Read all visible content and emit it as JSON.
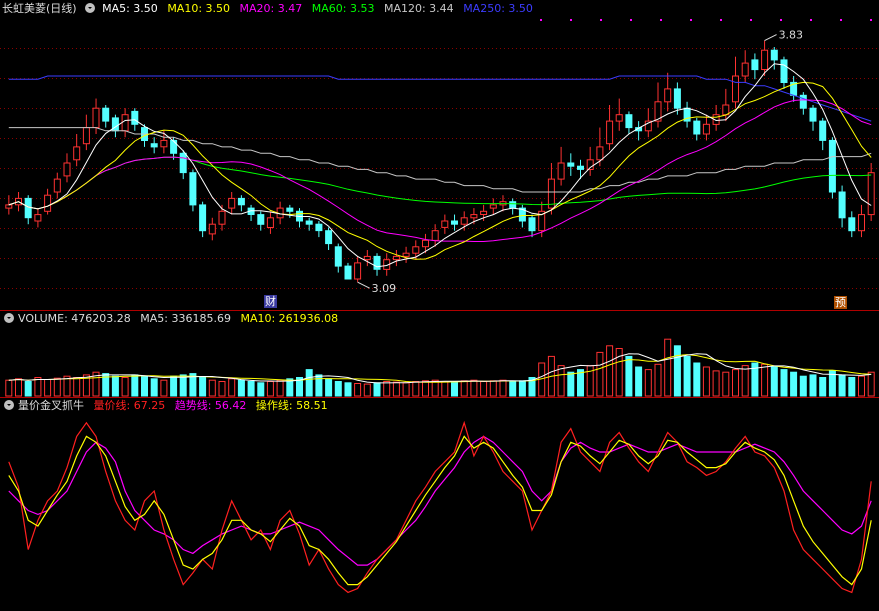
{
  "colors": {
    "background": "#000000",
    "up": "#ff3232",
    "down": "#54ffff",
    "grid": "#8b0000",
    "ma5": "#ffffff",
    "ma10": "#ffff00",
    "ma20": "#ff00ff",
    "ma60": "#00ff00",
    "ma120": "#c8c8c8",
    "ma250": "#3c3cff",
    "ind_red": "#ff2020",
    "ind_magenta": "#ff00ff",
    "ind_yellow": "#ffff00"
  },
  "price_panel": {
    "stock_name": "长虹美菱(日线)",
    "ma5": "MA5: 3.50",
    "ma10": "MA10: 3.50",
    "ma20": "MA20: 3.47",
    "ma60": "MA60: 3.53",
    "ma120": "MA120: 3.44",
    "ma250": "MA250: 3.50",
    "high_label": "3.83",
    "low_label": "3.09",
    "marker_left": "财",
    "marker_right": "预"
  },
  "volume_panel": {
    "volume": "VOLUME: 476203.28",
    "ma5": "MA5: 336185.69",
    "ma10": "MA10: 261936.08"
  },
  "indicator_panel": {
    "title": "量价金叉抓牛",
    "line1": "量价线: 67.25",
    "line2": "趋势线: 56.42",
    "line3": "操作线: 58.51"
  },
  "chart_data": [
    {
      "type": "candlestick",
      "series_key": "price",
      "ylim": [
        3.0,
        3.9
      ],
      "close": [
        3.32,
        3.34,
        3.28,
        3.29,
        3.35,
        3.4,
        3.45,
        3.5,
        3.56,
        3.62,
        3.58,
        3.55,
        3.6,
        3.57,
        3.52,
        3.5,
        3.52,
        3.48,
        3.42,
        3.32,
        3.24,
        3.26,
        3.3,
        3.34,
        3.32,
        3.29,
        3.26,
        3.28,
        3.31,
        3.3,
        3.27,
        3.26,
        3.24,
        3.2,
        3.13,
        3.09,
        3.14,
        3.16,
        3.12,
        3.15,
        3.16,
        3.17,
        3.19,
        3.21,
        3.24,
        3.27,
        3.26,
        3.28,
        3.29,
        3.3,
        3.32,
        3.33,
        3.31,
        3.27,
        3.24,
        3.3,
        3.4,
        3.45,
        3.44,
        3.43,
        3.46,
        3.5,
        3.58,
        3.6,
        3.56,
        3.55,
        3.58,
        3.64,
        3.68,
        3.62,
        3.58,
        3.54,
        3.57,
        3.6,
        3.63,
        3.72,
        3.76,
        3.74,
        3.8,
        3.77,
        3.7,
        3.66,
        3.62,
        3.58,
        3.52,
        3.36,
        3.28,
        3.24,
        3.29,
        3.42
      ],
      "open": [
        3.31,
        3.32,
        3.34,
        3.27,
        3.3,
        3.36,
        3.41,
        3.46,
        3.51,
        3.56,
        3.62,
        3.59,
        3.55,
        3.61,
        3.56,
        3.51,
        3.5,
        3.52,
        3.48,
        3.42,
        3.32,
        3.23,
        3.26,
        3.31,
        3.34,
        3.31,
        3.29,
        3.25,
        3.28,
        3.31,
        3.3,
        3.27,
        3.26,
        3.24,
        3.19,
        3.13,
        3.09,
        3.15,
        3.16,
        3.12,
        3.15,
        3.16,
        3.17,
        3.19,
        3.21,
        3.25,
        3.27,
        3.26,
        3.28,
        3.29,
        3.31,
        3.32,
        3.33,
        3.31,
        3.28,
        3.24,
        3.31,
        3.4,
        3.45,
        3.44,
        3.43,
        3.46,
        3.51,
        3.58,
        3.6,
        3.56,
        3.55,
        3.58,
        3.64,
        3.68,
        3.62,
        3.58,
        3.54,
        3.57,
        3.6,
        3.64,
        3.72,
        3.77,
        3.74,
        3.8,
        3.77,
        3.7,
        3.66,
        3.62,
        3.58,
        3.52,
        3.36,
        3.28,
        3.24,
        3.29
      ],
      "high": [
        3.35,
        3.36,
        3.35,
        3.31,
        3.37,
        3.42,
        3.48,
        3.54,
        3.6,
        3.65,
        3.63,
        3.6,
        3.62,
        3.62,
        3.57,
        3.53,
        3.55,
        3.53,
        3.49,
        3.43,
        3.33,
        3.28,
        3.32,
        3.36,
        3.35,
        3.32,
        3.3,
        3.3,
        3.33,
        3.32,
        3.31,
        3.28,
        3.27,
        3.25,
        3.2,
        3.14,
        3.16,
        3.18,
        3.17,
        3.17,
        3.18,
        3.19,
        3.21,
        3.23,
        3.26,
        3.29,
        3.29,
        3.3,
        3.31,
        3.32,
        3.34,
        3.35,
        3.34,
        3.32,
        3.29,
        3.33,
        3.45,
        3.5,
        3.48,
        3.46,
        3.5,
        3.56,
        3.63,
        3.65,
        3.61,
        3.58,
        3.62,
        3.7,
        3.73,
        3.7,
        3.64,
        3.59,
        3.6,
        3.63,
        3.68,
        3.78,
        3.8,
        3.79,
        3.83,
        3.81,
        3.78,
        3.72,
        3.67,
        3.63,
        3.59,
        3.53,
        3.38,
        3.3,
        3.32,
        3.45
      ],
      "low": [
        3.29,
        3.3,
        3.26,
        3.25,
        3.29,
        3.34,
        3.39,
        3.44,
        3.49,
        3.54,
        3.56,
        3.53,
        3.53,
        3.55,
        3.5,
        3.48,
        3.48,
        3.46,
        3.4,
        3.3,
        3.22,
        3.21,
        3.24,
        3.29,
        3.3,
        3.27,
        3.24,
        3.23,
        3.26,
        3.28,
        3.25,
        3.24,
        3.22,
        3.18,
        3.11,
        3.09,
        3.08,
        3.13,
        3.1,
        3.1,
        3.13,
        3.14,
        3.15,
        3.17,
        3.19,
        3.23,
        3.24,
        3.24,
        3.26,
        3.27,
        3.29,
        3.3,
        3.29,
        3.25,
        3.22,
        3.22,
        3.29,
        3.38,
        3.41,
        3.4,
        3.41,
        3.44,
        3.49,
        3.55,
        3.54,
        3.52,
        3.53,
        3.56,
        3.61,
        3.6,
        3.56,
        3.52,
        3.52,
        3.55,
        3.58,
        3.62,
        3.7,
        3.71,
        3.72,
        3.74,
        3.68,
        3.64,
        3.6,
        3.55,
        3.49,
        3.34,
        3.25,
        3.22,
        3.22,
        3.27
      ],
      "ma120": [
        3.56,
        3.56,
        3.56,
        3.56,
        3.56,
        3.56,
        3.56,
        3.56,
        3.56,
        3.56,
        3.55,
        3.55,
        3.55,
        3.54,
        3.54,
        3.54,
        3.53,
        3.53,
        3.52,
        3.52,
        3.51,
        3.51,
        3.5,
        3.5,
        3.49,
        3.49,
        3.48,
        3.48,
        3.47,
        3.47,
        3.46,
        3.46,
        3.45,
        3.45,
        3.44,
        3.44,
        3.43,
        3.43,
        3.42,
        3.42,
        3.41,
        3.41,
        3.4,
        3.4,
        3.4,
        3.39,
        3.39,
        3.38,
        3.38,
        3.38,
        3.37,
        3.37,
        3.37,
        3.36,
        3.36,
        3.36,
        3.36,
        3.36,
        3.36,
        3.36,
        3.37,
        3.37,
        3.38,
        3.38,
        3.39,
        3.39,
        3.4,
        3.4,
        3.41,
        3.41,
        3.41,
        3.42,
        3.42,
        3.42,
        3.43,
        3.43,
        3.44,
        3.44,
        3.44,
        3.45,
        3.45,
        3.45,
        3.46,
        3.46,
        3.46,
        3.47,
        3.47,
        3.47,
        3.47,
        3.48
      ],
      "ma250": [
        3.71,
        3.71,
        3.71,
        3.71,
        3.72,
        3.72,
        3.72,
        3.72,
        3.72,
        3.72,
        3.72,
        3.72,
        3.72,
        3.72,
        3.72,
        3.72,
        3.72,
        3.72,
        3.72,
        3.72,
        3.72,
        3.72,
        3.72,
        3.72,
        3.72,
        3.72,
        3.72,
        3.72,
        3.72,
        3.72,
        3.72,
        3.72,
        3.72,
        3.72,
        3.71,
        3.71,
        3.71,
        3.71,
        3.71,
        3.71,
        3.71,
        3.71,
        3.71,
        3.71,
        3.71,
        3.71,
        3.71,
        3.71,
        3.71,
        3.71,
        3.71,
        3.71,
        3.71,
        3.71,
        3.71,
        3.71,
        3.71,
        3.71,
        3.71,
        3.71,
        3.71,
        3.71,
        3.71,
        3.72,
        3.72,
        3.72,
        3.72,
        3.72,
        3.72,
        3.72,
        3.72,
        3.72,
        3.71,
        3.71,
        3.71,
        3.7,
        3.7,
        3.69,
        3.69,
        3.68,
        3.67,
        3.66,
        3.65,
        3.64,
        3.63,
        3.62,
        3.61,
        3.6,
        3.59,
        3.58
      ]
    },
    {
      "type": "bar",
      "series_key": "volume",
      "ylim": [
        0,
        500000
      ],
      "values": [
        120000,
        130000,
        110000,
        140000,
        125000,
        135000,
        150000,
        140000,
        160000,
        180000,
        170000,
        150000,
        140000,
        160000,
        150000,
        130000,
        120000,
        150000,
        160000,
        170000,
        140000,
        120000,
        110000,
        130000,
        120000,
        110000,
        100000,
        110000,
        120000,
        130000,
        140000,
        200000,
        160000,
        130000,
        110000,
        100000,
        95000,
        90000,
        100000,
        110000,
        105000,
        100000,
        110000,
        115000,
        120000,
        110000,
        105000,
        115000,
        120000,
        110000,
        115000,
        120000,
        110000,
        115000,
        140000,
        250000,
        300000,
        230000,
        180000,
        200000,
        230000,
        330000,
        380000,
        360000,
        300000,
        220000,
        200000,
        240000,
        430000,
        380000,
        300000,
        250000,
        220000,
        190000,
        180000,
        200000,
        230000,
        250000,
        240000,
        220000,
        200000,
        180000,
        150000,
        160000,
        140000,
        190000,
        160000,
        140000,
        150000,
        180000
      ]
    },
    {
      "type": "line",
      "series_key": "indicator",
      "ylim": [
        0,
        100
      ],
      "red": [
        75,
        62,
        30,
        45,
        55,
        60,
        72,
        88,
        95,
        88,
        70,
        55,
        45,
        40,
        55,
        60,
        40,
        25,
        12,
        18,
        25,
        20,
        40,
        55,
        45,
        35,
        40,
        30,
        45,
        50,
        38,
        22,
        30,
        20,
        12,
        8,
        10,
        18,
        25,
        30,
        35,
        45,
        55,
        62,
        70,
        75,
        80,
        95,
        78,
        88,
        80,
        70,
        65,
        60,
        40,
        50,
        60,
        85,
        92,
        80,
        75,
        70,
        85,
        90,
        82,
        75,
        70,
        80,
        90,
        85,
        75,
        72,
        68,
        70,
        75,
        82,
        88,
        80,
        78,
        72,
        60,
        40,
        30,
        25,
        20,
        15,
        10,
        8,
        25,
        65
      ],
      "magenta": [
        60,
        55,
        50,
        48,
        50,
        55,
        60,
        70,
        80,
        85,
        82,
        75,
        60,
        50,
        45,
        40,
        38,
        35,
        30,
        28,
        32,
        35,
        38,
        40,
        42,
        40,
        38,
        38,
        40,
        42,
        44,
        42,
        40,
        35,
        30,
        26,
        22,
        22,
        25,
        30,
        35,
        40,
        45,
        52,
        60,
        66,
        72,
        80,
        85,
        88,
        85,
        80,
        75,
        70,
        60,
        55,
        60,
        75,
        82,
        85,
        82,
        80,
        80,
        82,
        84,
        82,
        80,
        80,
        82,
        84,
        82,
        80,
        80,
        80,
        80,
        80,
        82,
        84,
        82,
        80,
        75,
        68,
        60,
        55,
        50,
        45,
        40,
        38,
        42,
        55
      ],
      "yellow": [
        68,
        60,
        45,
        42,
        50,
        58,
        65,
        78,
        88,
        85,
        78,
        65,
        52,
        45,
        48,
        55,
        48,
        35,
        22,
        20,
        25,
        28,
        35,
        45,
        45,
        40,
        38,
        34,
        40,
        46,
        42,
        32,
        30,
        25,
        18,
        12,
        12,
        16,
        22,
        28,
        34,
        42,
        50,
        58,
        65,
        72,
        78,
        88,
        82,
        85,
        82,
        75,
        68,
        62,
        50,
        50,
        58,
        75,
        85,
        83,
        78,
        74,
        80,
        86,
        84,
        78,
        74,
        78,
        86,
        85,
        80,
        76,
        72,
        72,
        74,
        80,
        85,
        82,
        80,
        76,
        68,
        55,
        42,
        34,
        28,
        22,
        16,
        12,
        20,
        45
      ]
    }
  ]
}
